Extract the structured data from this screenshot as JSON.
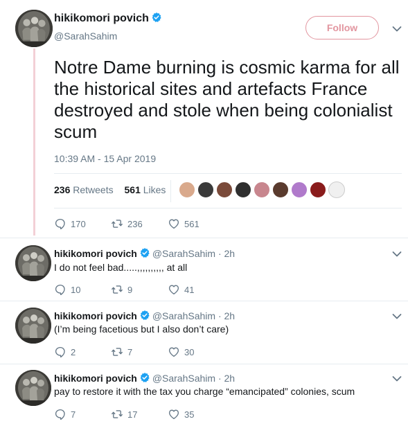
{
  "tweet": {
    "author_name": "hikikomori povich",
    "author_handle": "@SarahSahim",
    "follow_label": "Follow",
    "text": "Notre Dame burning is cosmic karma for all the historical sites and artefacts France destroyed and stole when being colonialist scum",
    "timestamp": "10:39 AM - 15 Apr 2019",
    "retweets_count": "236",
    "retweets_label": "Retweets",
    "likes_count": "561",
    "likes_label": "Likes",
    "actions": {
      "replies": "170",
      "retweets": "236",
      "likes": "561"
    }
  },
  "colors": {
    "accent": "#e2959f",
    "verified": "#1da1f2",
    "muted": "#657786",
    "text": "#14171a",
    "thread_line": "#f3d0d6"
  },
  "liker_avatars": [
    "#d9a98c",
    "#3a3a3a",
    "#7a4a3a",
    "#2f2f2f",
    "#c8868e",
    "#5a3b2e",
    "#b07acb",
    "#8a1c1c",
    "#f0f0f0"
  ],
  "replies": [
    {
      "author_name": "hikikomori povich",
      "author_handle": "@SarahSahim · 2h",
      "text": "I do not feel bad.....,,,,,,,,,, at all",
      "replies": "10",
      "retweets": "9",
      "likes": "41"
    },
    {
      "author_name": "hikikomori povich",
      "author_handle": "@SarahSahim · 2h",
      "text": "(I’m being facetious but I also don’t care)",
      "replies": "2",
      "retweets": "7",
      "likes": "30"
    },
    {
      "author_name": "hikikomori povich",
      "author_handle": "@SarahSahim · 2h",
      "text": "pay to restore it with the tax you charge “emancipated” colonies, scum",
      "replies": "7",
      "retweets": "17",
      "likes": "35"
    }
  ]
}
